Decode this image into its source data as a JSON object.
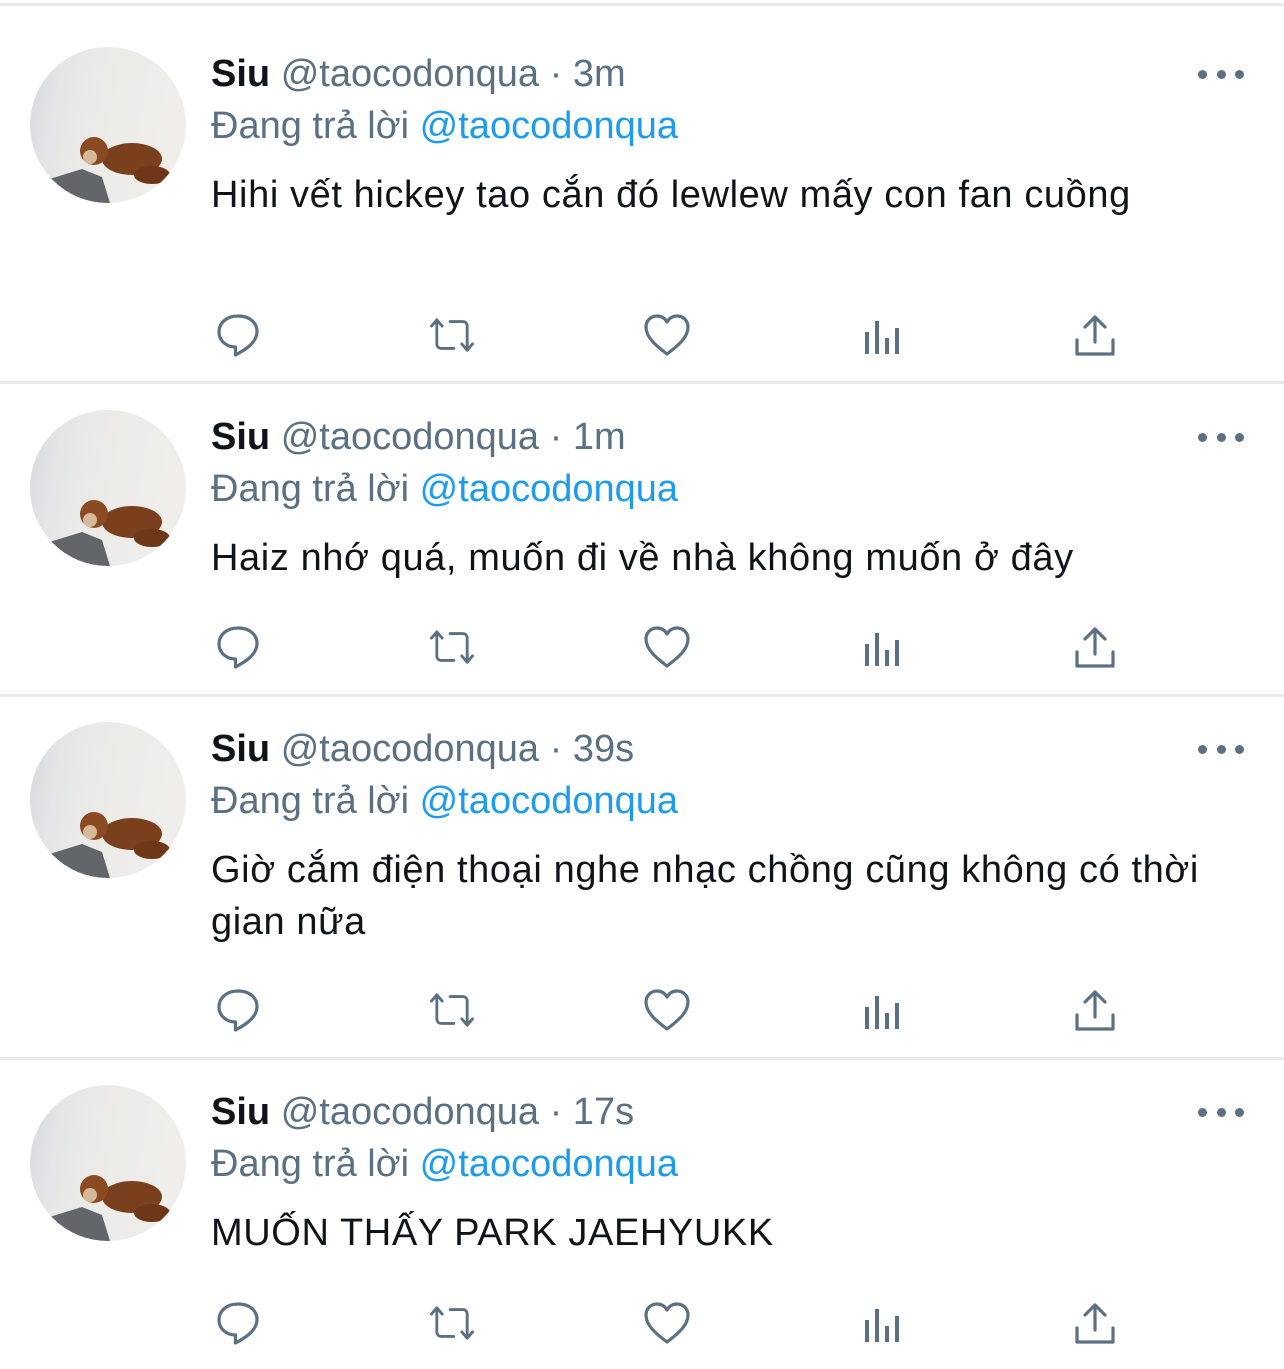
{
  "tweets": [
    {
      "name": "Siu",
      "handle": "@taocodonqua",
      "separator": "·",
      "time": "3m",
      "reply_prefix": "Đang trả lời",
      "reply_to": "@taocodonqua",
      "text": "Hihi vết hickey tao cắn đó lewlew mấy con fan cuồng"
    },
    {
      "name": "Siu",
      "handle": "@taocodonqua",
      "separator": "·",
      "time": "1m",
      "reply_prefix": "Đang trả lời",
      "reply_to": "@taocodonqua",
      "text": "Haiz nhớ quá, muốn đi về nhà không muốn ở đây"
    },
    {
      "name": "Siu",
      "handle": "@taocodonqua",
      "separator": "·",
      "time": "39s",
      "reply_prefix": "Đang trả lời",
      "reply_to": "@taocodonqua",
      "text": "Giờ cắm điện thoại nghe nhạc chồng cũng không có thời gian nữa"
    },
    {
      "name": "Siu",
      "handle": "@taocodonqua",
      "separator": "·",
      "time": "17s",
      "reply_prefix": "Đang trả lời",
      "reply_to": "@taocodonqua",
      "text": "MUỐN THẤY PARK JAEHYUKK"
    }
  ],
  "icons": {
    "reply": "reply-icon",
    "retweet": "retweet-icon",
    "like": "heart-icon",
    "stats": "analytics-icon",
    "share": "share-icon",
    "more": "more-dots-icon"
  },
  "colors": {
    "text": "#0f1419",
    "secondary": "#5b7083",
    "accent": "#1d9bf0",
    "divider": "#e8ebed"
  }
}
